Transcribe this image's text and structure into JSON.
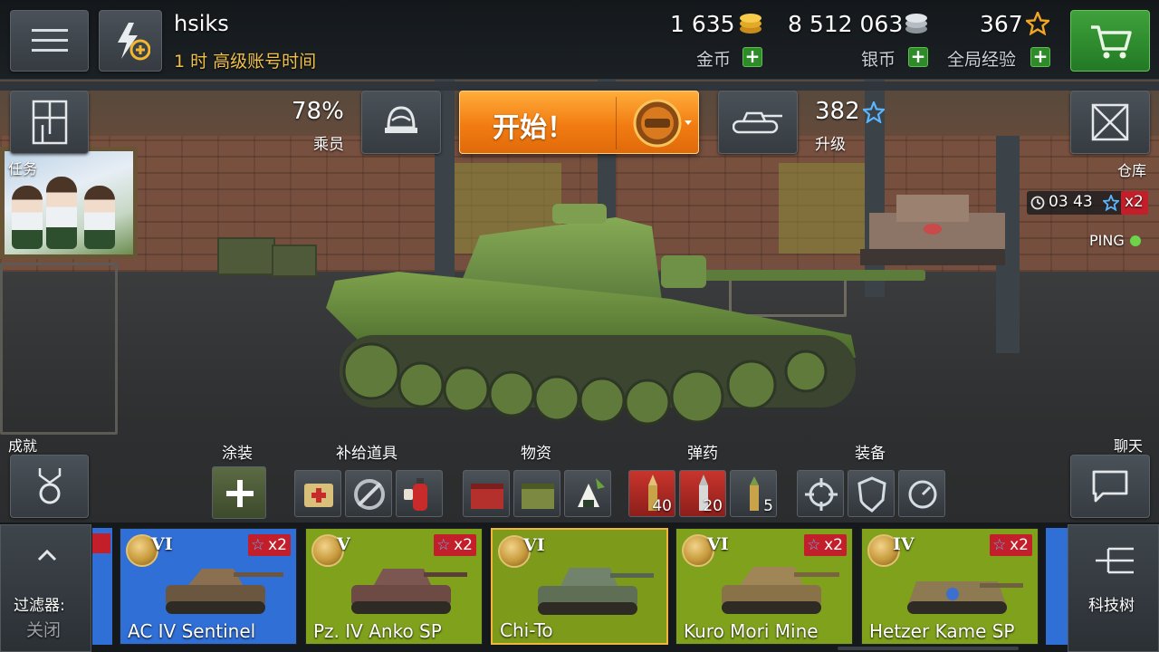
{
  "player": {
    "name": "hsiks",
    "premium_time": "1 时 高级账号时间"
  },
  "currencies": {
    "gold": {
      "value": "1 635",
      "label": "金币"
    },
    "silver": {
      "value": "8 512 063",
      "label": "银币"
    },
    "free_xp": {
      "value": "367",
      "label": "全局经验"
    }
  },
  "crew": {
    "percent": "78%",
    "label": "乘员"
  },
  "start_button": {
    "label": "开始！"
  },
  "upgrade": {
    "value": "382",
    "label": "升级"
  },
  "left_labels": {
    "missions": "任务",
    "achievements": "成就"
  },
  "right_labels": {
    "depot": "仓库",
    "chat": "聊天"
  },
  "boost_timer": {
    "time": "03 43",
    "multiplier": "x2"
  },
  "ping": {
    "label": "PING",
    "status_color": "#6cd34a"
  },
  "sections": {
    "camo": "涂装",
    "consumables": "补给道具",
    "provisions": "物资",
    "ammo": "弹药",
    "equipment": "装备"
  },
  "ammo_counts": [
    "40",
    "20",
    "5"
  ],
  "filter": {
    "label": "过滤器:",
    "state": "关闭"
  },
  "tech_tree": {
    "label": "科技树"
  },
  "tank_carousel": [
    {
      "name": "AC IV Sentinel",
      "tier": "VI",
      "bonus": "x2",
      "bg": "#2f6fd6",
      "selected": false
    },
    {
      "name": "Pz. IV Anko SP",
      "tier": "V",
      "bonus": "x2",
      "bg": "#7fa11b",
      "selected": false
    },
    {
      "name": "Chi-To",
      "tier": "VI",
      "bonus": "",
      "bg": "#7d9a1a",
      "selected": true
    },
    {
      "name": "Kuro Mori Mine",
      "tier": "VI",
      "bonus": "x2",
      "bg": "#7fa11b",
      "selected": false
    },
    {
      "name": "Hetzer Kame SP",
      "tier": "IV",
      "bonus": "x2",
      "bg": "#7fa11b",
      "selected": false
    }
  ],
  "colors": {
    "accent_orange": "#f27c12",
    "shop_green": "#2f8a2a",
    "xp_star": "#f2a623",
    "premium_text": "#f0c14a"
  }
}
